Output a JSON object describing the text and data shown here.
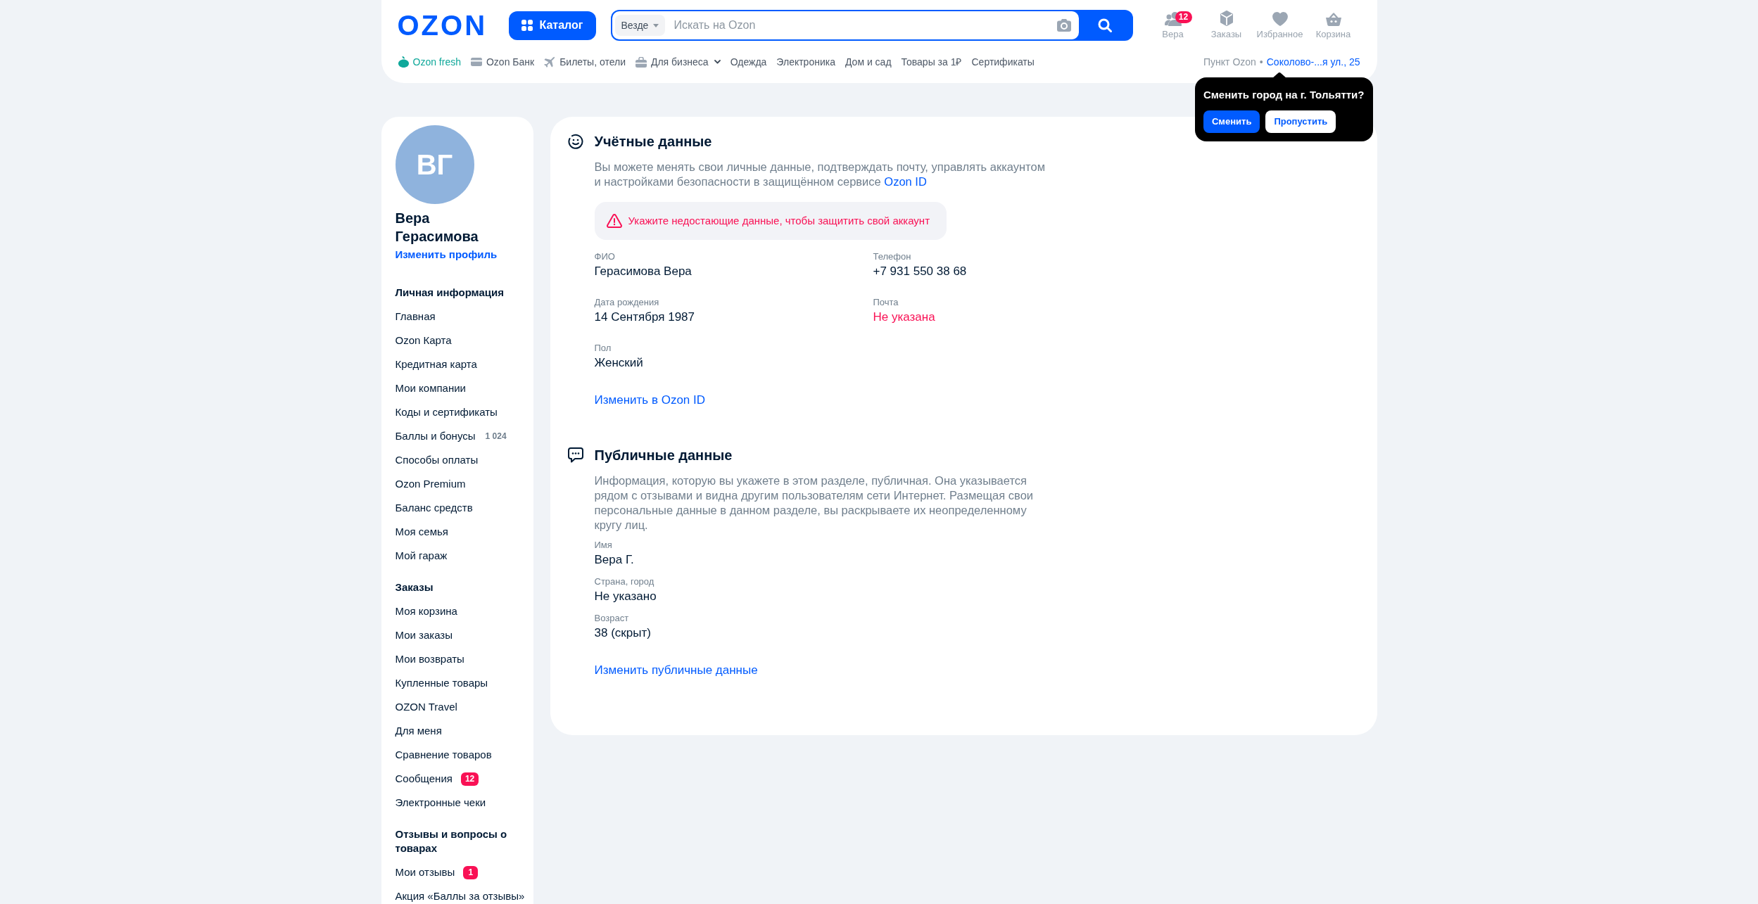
{
  "header": {
    "logo": "OZON",
    "catalog_button": "Каталог",
    "search": {
      "scope": "Везде",
      "placeholder": "Искать на Ozon"
    },
    "actions": [
      {
        "label": "Вера",
        "kind": "profile",
        "badge": "12"
      },
      {
        "label": "Заказы",
        "kind": "orders"
      },
      {
        "label": "Избранное",
        "kind": "favorites"
      },
      {
        "label": "Корзина",
        "kind": "cart"
      }
    ],
    "nav": [
      {
        "label": "Ozon fresh",
        "kind": "fresh"
      },
      {
        "label": "Ozon Банк",
        "kind": "bank"
      },
      {
        "label": "Билеты, отели",
        "kind": "travel"
      },
      {
        "label": "Для бизнеса",
        "kind": "business"
      },
      {
        "label": "Одежда",
        "kind": "link"
      },
      {
        "label": "Электроника",
        "kind": "link"
      },
      {
        "label": "Дом и сад",
        "kind": "link"
      },
      {
        "label": "Товары за 1₽",
        "kind": "link"
      },
      {
        "label": "Сертификаты",
        "kind": "link"
      }
    ],
    "pickup": {
      "label": "Пункт Ozon",
      "separator": "•",
      "address": "Соколово-...я ул., 25"
    }
  },
  "city_popup": {
    "question": "Сменить город на г. Тольятти?",
    "buttons": [
      {
        "label": "Сменить",
        "kind": "primary"
      },
      {
        "label": "Пропустить",
        "kind": "secondary"
      }
    ]
  },
  "sidebar": {
    "avatar_initials": "ВГ",
    "name": "Вера Герасимова",
    "edit_link": "Изменить профиль",
    "sections": [
      {
        "title": "Личная информация",
        "items": [
          {
            "label": "Главная"
          },
          {
            "label": "Ozon Карта"
          },
          {
            "label": "Кредитная карта"
          },
          {
            "label": "Мои компании"
          },
          {
            "label": "Коды и сертификаты"
          },
          {
            "label": "Баллы и бонусы",
            "count": "1 024"
          },
          {
            "label": "Способы оплаты"
          },
          {
            "label": "Ozon Premium"
          },
          {
            "label": "Баланс средств"
          },
          {
            "label": "Моя семья"
          },
          {
            "label": "Мой гараж"
          }
        ]
      },
      {
        "title": "Заказы",
        "items": [
          {
            "label": "Моя корзина"
          },
          {
            "label": "Мои заказы"
          },
          {
            "label": "Мои возвраты"
          },
          {
            "label": "Купленные товары"
          },
          {
            "label": "OZON Travel"
          },
          {
            "label": "Для меня"
          },
          {
            "label": "Сравнение товаров"
          },
          {
            "label": "Сообщения",
            "badge": "12"
          },
          {
            "label": "Электронные чеки"
          }
        ]
      },
      {
        "title": "Отзывы и вопросы о товарах",
        "items": [
          {
            "label": "Мои отзывы",
            "badge": "1"
          },
          {
            "label": "Акция «Баллы за отзывы»"
          }
        ]
      }
    ]
  },
  "main": {
    "sections": [
      {
        "kind": "account",
        "title": "Учётные данные",
        "description": "Вы можете менять свои личные данные, подтверждать почту, управлять аккаунтом и настройками безопасности в защищённом сервисе",
        "description_link": "Ozon ID",
        "alert": "Укажите недостающие данные, чтобы защитить свой аккаунт",
        "fields": [
          {
            "label": "ФИО",
            "value": "Герасимова Вера",
            "missing": false
          },
          {
            "label": "Телефон",
            "value": "+7 931 550 38 68",
            "missing": false
          },
          {
            "label": "Дата рождения",
            "value": "14 Сентября 1987",
            "missing": false
          },
          {
            "label": "Почта",
            "value": "Не указана",
            "missing": true
          },
          {
            "label": "Пол",
            "value": "Женский",
            "missing": false
          }
        ],
        "link": "Изменить в Ozon ID"
      },
      {
        "kind": "public",
        "title": "Публичные данные",
        "description": "Информация, которую вы укажете в этом разделе, публичная. Она указывается рядом с отзывами и видна другим пользователям сети Интернет. Размещая свои персональные данные в данном разделе, вы раскрываете их неопределенному кругу лиц.",
        "fields": [
          {
            "label": "Имя",
            "value": "Вера Г.",
            "missing": false
          },
          {
            "label": "Страна, город",
            "value": "Не указано",
            "missing": false
          },
          {
            "label": "Возраст",
            "value": "38 (скрыт)",
            "missing": false
          }
        ],
        "link": "Изменить публичные данные"
      }
    ]
  }
}
